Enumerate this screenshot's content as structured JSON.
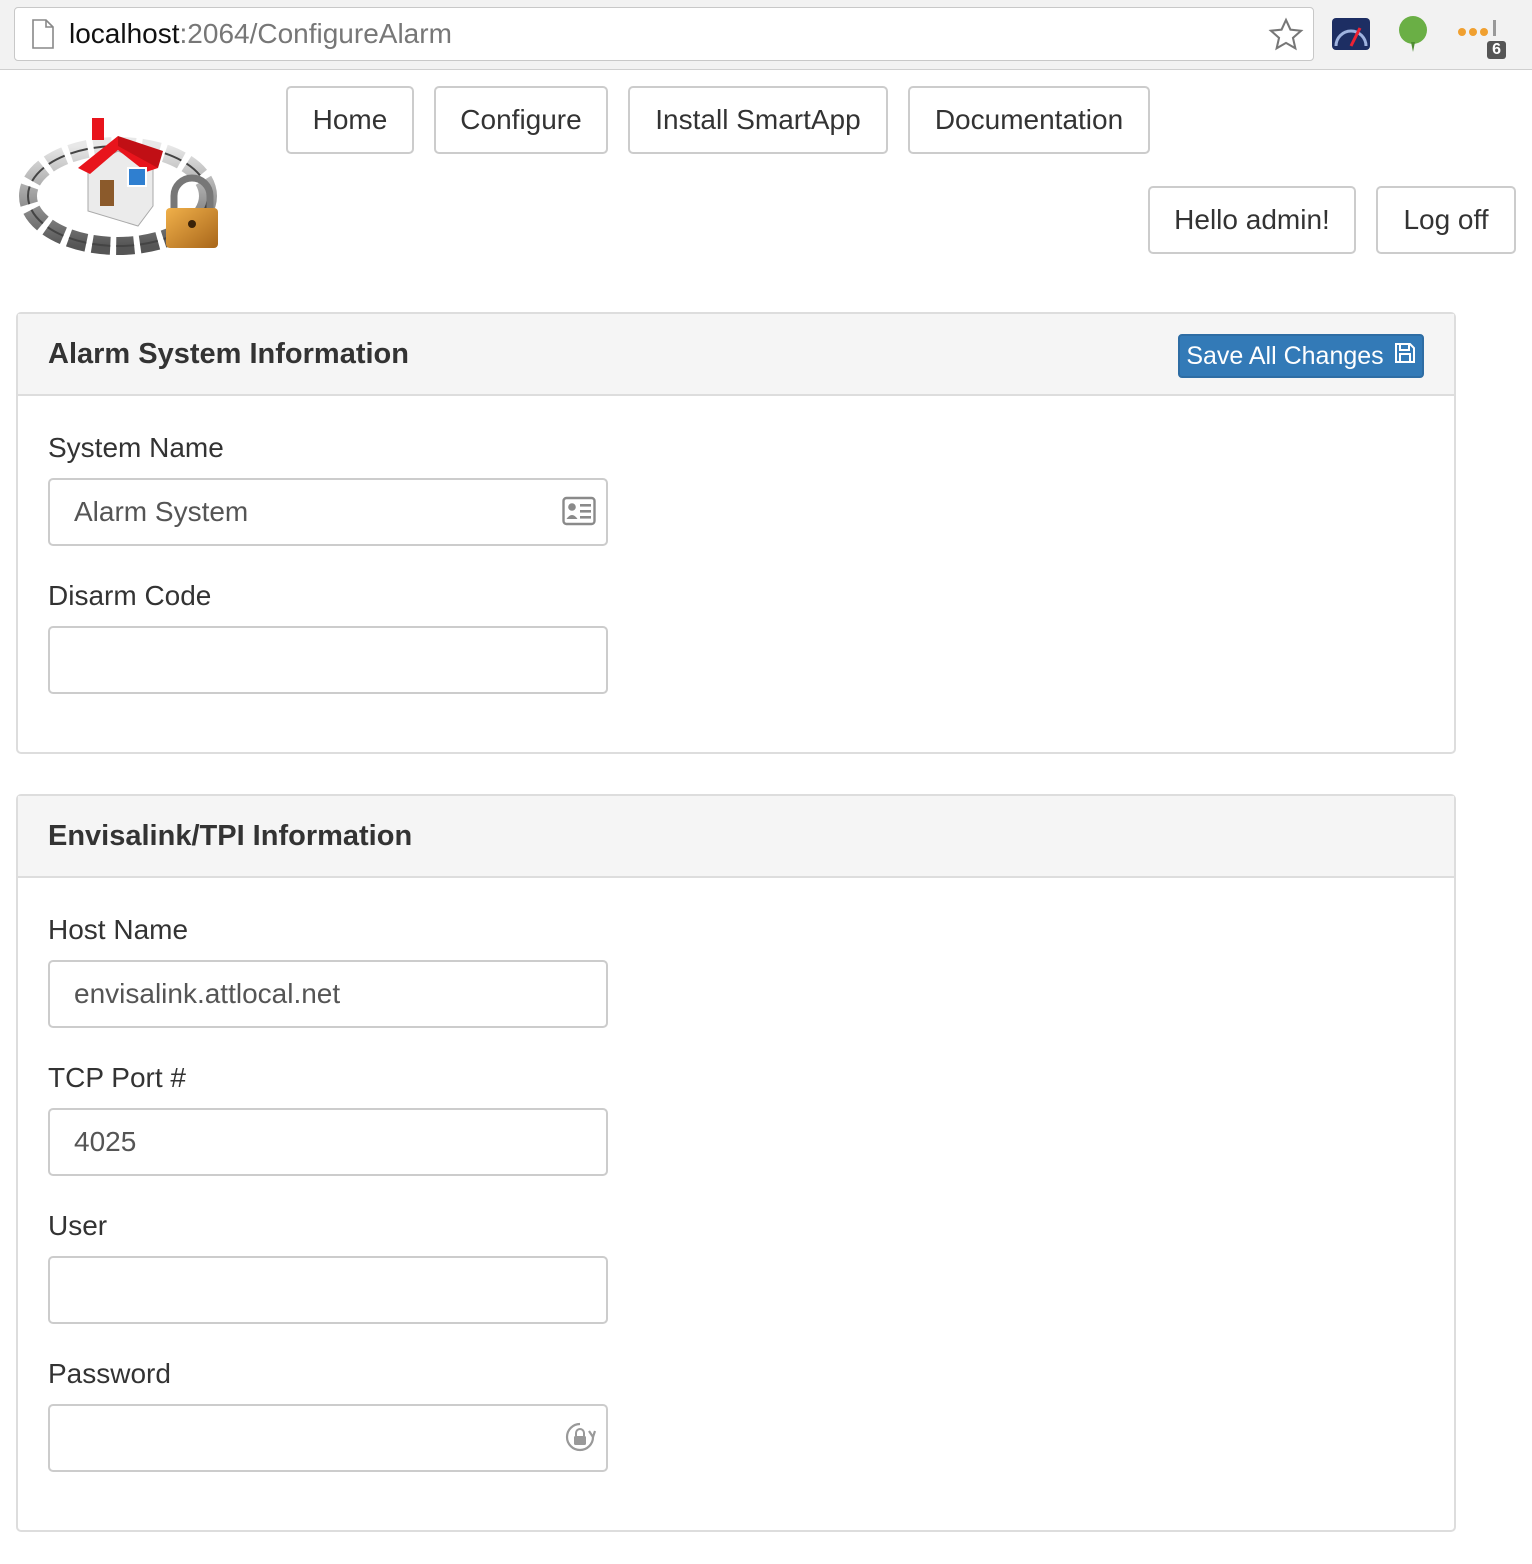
{
  "browser": {
    "url_host": "localhost",
    "url_path": ":2064/ConfigureAlarm",
    "extension_badge": "6"
  },
  "nav": {
    "home": "Home",
    "configure": "Configure",
    "install": "Install SmartApp",
    "documentation": "Documentation"
  },
  "user": {
    "greeting": "Hello admin!",
    "logoff": "Log off"
  },
  "alarm_panel": {
    "title": "Alarm System Information",
    "save_label": "Save All Changes",
    "system_name_label": "System Name",
    "system_name_value": "Alarm System",
    "disarm_code_label": "Disarm Code",
    "disarm_code_value": ""
  },
  "tpi_panel": {
    "title": "Envisalink/TPI Information",
    "host_label": "Host Name",
    "host_value": "envisalink.attlocal.net",
    "port_label": "TCP Port #",
    "port_value": "4025",
    "user_label": "User",
    "user_value": "",
    "password_label": "Password",
    "password_value": ""
  },
  "colors": {
    "primary": "#337ab7",
    "panel_heading_bg": "#f5f5f5",
    "border": "#dddddd"
  }
}
